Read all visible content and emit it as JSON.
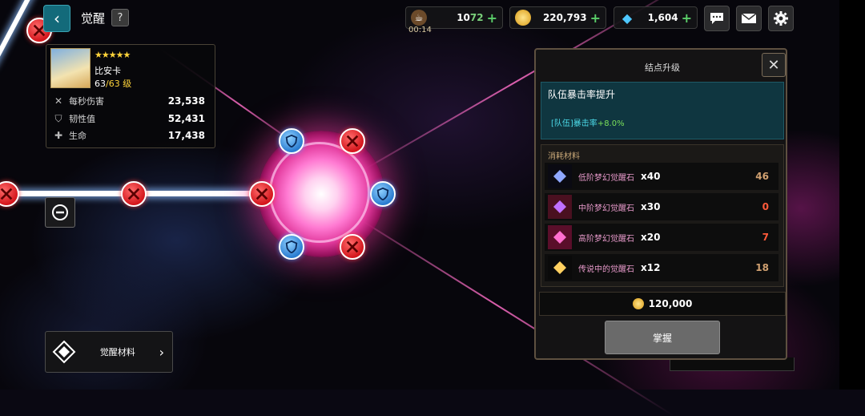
{
  "header": {
    "back_icon": "chevron-left-icon",
    "title": "觉醒",
    "help_label": "?"
  },
  "resources": {
    "stamina": {
      "icon": "coffee-cup-icon",
      "current": "10",
      "max": "72",
      "timer": "00:14"
    },
    "gold": {
      "icon": "gold-coin-icon",
      "value": "220,793"
    },
    "gems": {
      "icon": "diamond-icon",
      "value": "1,604"
    },
    "plus_symbol": "+"
  },
  "top_icons": [
    "chat-icon",
    "mail-icon",
    "settings-gear-icon"
  ],
  "hero": {
    "stars": "★★★★★",
    "name": "比安卡",
    "level_current": "63",
    "level_max": "/63 级",
    "stats": [
      {
        "icon": "crossed-swords-icon",
        "label": "每秒伤害",
        "value": "23,538"
      },
      {
        "icon": "shield-icon",
        "label": "韧性值",
        "value": "52,431"
      },
      {
        "icon": "cross-health-icon",
        "label": "生命",
        "value": "17,438"
      }
    ]
  },
  "materials_button": {
    "label": "觉醒材料",
    "icon": "awakening-emblem-icon",
    "arrow": "›"
  },
  "panel": {
    "title": "结点升级",
    "close_symbol": "✕",
    "node_name": "队伍暴击率提升",
    "effect_prefix": "[队伍]暴击率",
    "effect_bonus": "+8.0%",
    "materials_title": "消耗材料",
    "materials": [
      {
        "name": "低阶梦幻觉醒石",
        "qty": "x40",
        "owned": "46",
        "owned_color": "#d0a070",
        "gem_color": "#8fa8ff"
      },
      {
        "name": "中阶梦幻觉醒石",
        "qty": "x30",
        "owned": "0",
        "owned_color": "#ff5a3a",
        "gem_color": "#c070ff"
      },
      {
        "name": "高阶梦幻觉醒石",
        "qty": "x20",
        "owned": "7",
        "owned_color": "#ff5a3a",
        "gem_color": "#ff6fd0"
      },
      {
        "name": "传说中的觉醒石",
        "qty": "x12",
        "owned": "18",
        "owned_color": "#d0a070",
        "gem_color": "#ffd060"
      }
    ],
    "cost": "120,000",
    "master_button": "掌握"
  },
  "colors": {
    "accent_teal": "#136a7a",
    "node_red": "#d4161c",
    "node_blue": "#2a7cd0",
    "core_pink": "#ff7ad2"
  }
}
